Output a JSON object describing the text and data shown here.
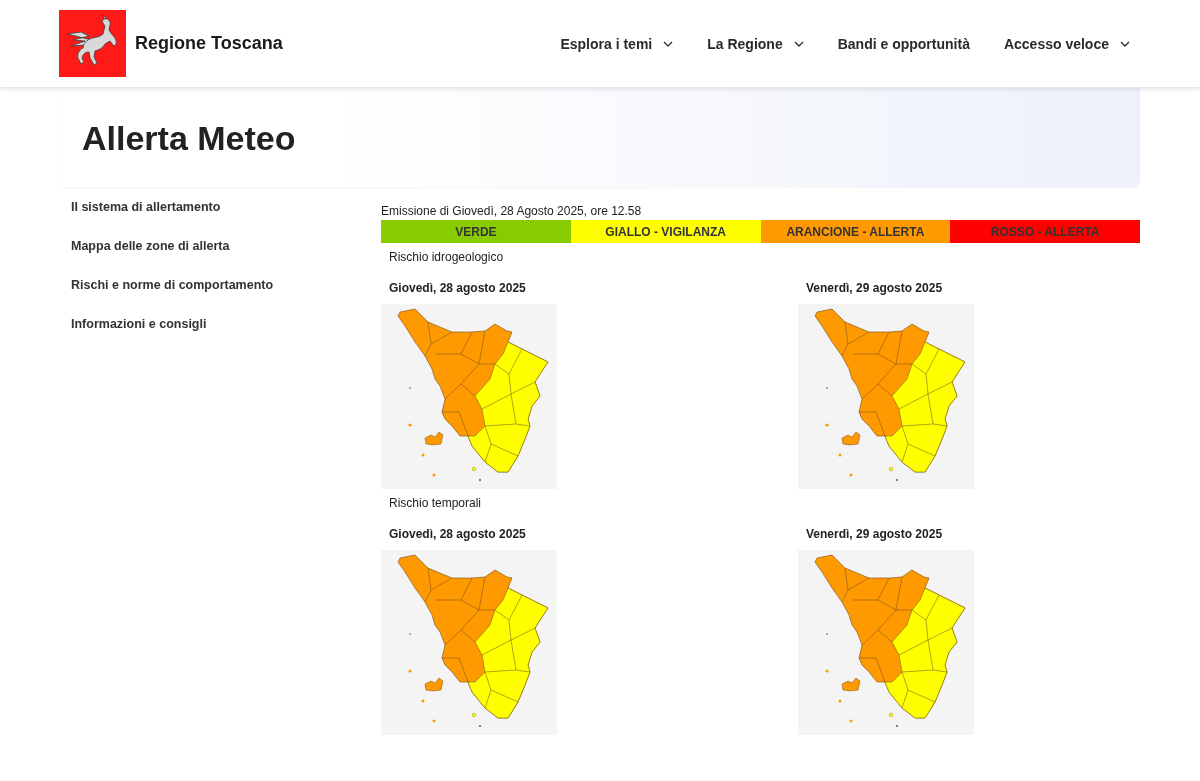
{
  "header": {
    "brand": "Regione Toscana",
    "nav": [
      {
        "label": "Esplora i temi",
        "has_menu": true
      },
      {
        "label": "La Regione",
        "has_menu": true
      },
      {
        "label": "Bandi e opportunità",
        "has_menu": false
      },
      {
        "label": "Accesso veloce",
        "has_menu": true
      }
    ]
  },
  "page_title": "Allerta Meteo",
  "sidebar": {
    "items": [
      {
        "label": "Il sistema di allertamento"
      },
      {
        "label": "Mappa delle zone di allerta"
      },
      {
        "label": "Rischi e norme di comportamento"
      },
      {
        "label": "Informazioni e consigli"
      }
    ]
  },
  "bulletin": {
    "emission": "Emissione di Giovedì, 28 Agosto 2025, ore 12.58",
    "legend": [
      {
        "label": "VERDE",
        "color": "#88cc00"
      },
      {
        "label": "GIALLO - VIGILANZA",
        "color": "#ffff00"
      },
      {
        "label": "ARANCIONE - ALLERTA",
        "color": "#ff9900"
      },
      {
        "label": "ROSSO - ALLERTA",
        "color": "#ff0000"
      }
    ],
    "risks": [
      {
        "title": "Rischio idrogeologico",
        "days": [
          {
            "date": "Giovedì, 28 agosto 2025"
          },
          {
            "date": "Venerdì, 29 agosto 2025"
          }
        ]
      },
      {
        "title": "Rischio temporali",
        "days": [
          {
            "date": "Giovedì, 28 agosto 2025"
          },
          {
            "date": "Venerdì, 29 agosto 2025"
          }
        ]
      }
    ]
  }
}
